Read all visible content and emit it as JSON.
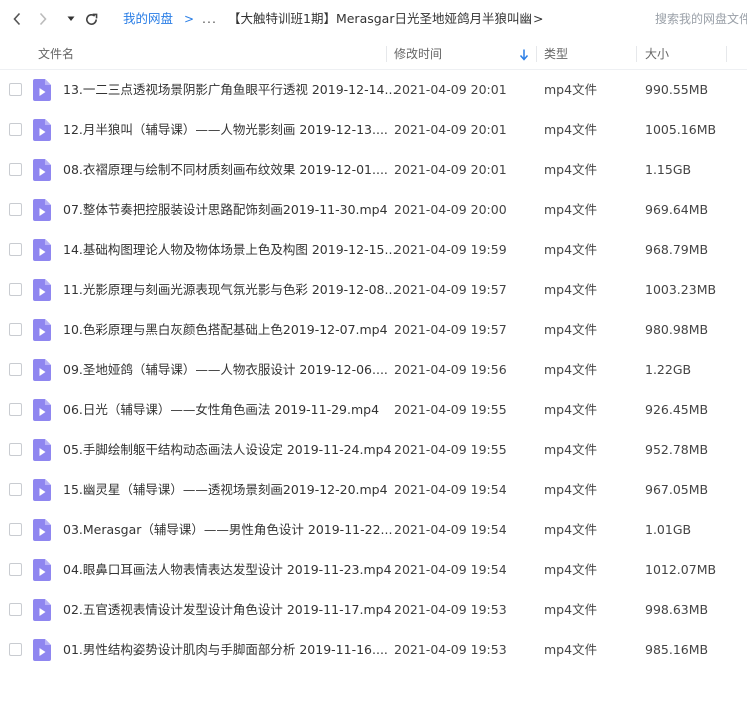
{
  "toolbar": {
    "back_icon": "chevron-left-icon",
    "forward_icon": "chevron-right-icon",
    "history_icon": "caret-down-icon",
    "refresh_icon": "refresh-icon",
    "root_link": "我的网盘",
    "separator": ">",
    "ellipsis": "...",
    "current_folder": "【大触特训班1期】Merasgar日光圣地娅鸽月半狼叫幽",
    "trailing_separator": ">",
    "search_placeholder": "搜索我的网盘文件"
  },
  "header": {
    "name": "文件名",
    "modified": "修改时间",
    "type": "类型",
    "size": "大小",
    "sort_icon": "sort-descending-icon"
  },
  "colors": {
    "accent": "#2a7ee6",
    "file_icon": "#8f86f0"
  },
  "files": [
    {
      "name": "13.一二三点透视场景阴影广角鱼眼平行透视 2019-12-14...",
      "modified": "2021-04-09 20:01",
      "type": "mp4文件",
      "size": "990.55MB"
    },
    {
      "name": "12.月半狼叫（辅导课）——人物光影刻画 2019-12-13....",
      "modified": "2021-04-09 20:01",
      "type": "mp4文件",
      "size": "1005.16MB"
    },
    {
      "name": "08.衣褶原理与绘制不同材质刻画布纹效果 2019-12-01....",
      "modified": "2021-04-09 20:01",
      "type": "mp4文件",
      "size": "1.15GB"
    },
    {
      "name": "07.整体节奏把控服装设计思路配饰刻画2019-11-30.mp4",
      "modified": "2021-04-09 20:00",
      "type": "mp4文件",
      "size": "969.64MB"
    },
    {
      "name": "14.基础构图理论人物及物体场景上色及构图 2019-12-15...",
      "modified": "2021-04-09 19:59",
      "type": "mp4文件",
      "size": "968.79MB"
    },
    {
      "name": "11.光影原理与刻画光源表现气氛光影与色彩 2019-12-08...",
      "modified": "2021-04-09 19:57",
      "type": "mp4文件",
      "size": "1003.23MB"
    },
    {
      "name": "10.色彩原理与黑白灰颜色搭配基础上色2019-12-07.mp4",
      "modified": "2021-04-09 19:57",
      "type": "mp4文件",
      "size": "980.98MB"
    },
    {
      "name": "09.圣地娅鸽（辅导课）——人物衣服设计 2019-12-06....",
      "modified": "2021-04-09 19:56",
      "type": "mp4文件",
      "size": "1.22GB"
    },
    {
      "name": "06.日光（辅导课）——女性角色画法 2019-11-29.mp4",
      "modified": "2021-04-09 19:55",
      "type": "mp4文件",
      "size": "926.45MB"
    },
    {
      "name": "05.手脚绘制躯干结构动态画法人设设定 2019-11-24.mp4",
      "modified": "2021-04-09 19:55",
      "type": "mp4文件",
      "size": "952.78MB"
    },
    {
      "name": "15.幽灵星（辅导课）——透视场景刻画2019-12-20.mp4",
      "modified": "2021-04-09 19:54",
      "type": "mp4文件",
      "size": "967.05MB"
    },
    {
      "name": "03.Merasgar（辅导课）——男性角色设计 2019-11-22...",
      "modified": "2021-04-09 19:54",
      "type": "mp4文件",
      "size": "1.01GB"
    },
    {
      "name": "04.眼鼻口耳画法人物表情表达发型设计 2019-11-23.mp4",
      "modified": "2021-04-09 19:54",
      "type": "mp4文件",
      "size": "1012.07MB"
    },
    {
      "name": "02.五官透视表情设计发型设计角色设计 2019-11-17.mp4",
      "modified": "2021-04-09 19:53",
      "type": "mp4文件",
      "size": "998.63MB"
    },
    {
      "name": "01.男性结构姿势设计肌肉与手脚面部分析 2019-11-16....",
      "modified": "2021-04-09 19:53",
      "type": "mp4文件",
      "size": "985.16MB"
    }
  ]
}
